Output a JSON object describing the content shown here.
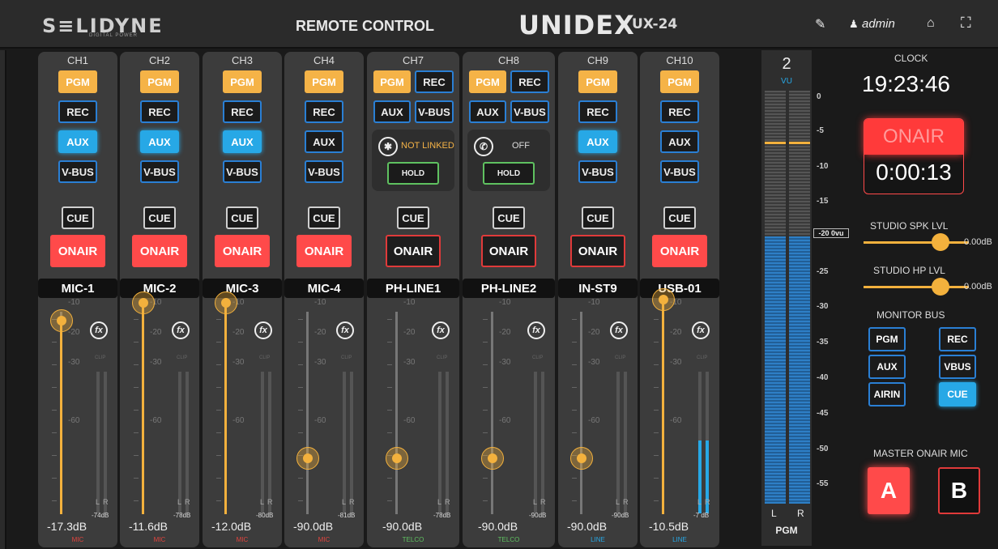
{
  "header": {
    "logo": "S≡LIDYNE",
    "logo_sub": "DIGITAL POWER",
    "title": "REMOTE CONTROL",
    "brand": "UNIDEX",
    "model": "UX-24",
    "user": "admin",
    "icons": [
      "pencil-icon",
      "user-icon",
      "home-icon",
      "fullscreen-icon"
    ]
  },
  "channels": [
    {
      "label": "CH1",
      "name": "MIC-1",
      "gain": "-17.3dB",
      "peak": "-74dB",
      "type": "MIC"
    },
    {
      "label": "CH2",
      "name": "MIC-2",
      "gain": "-11.6dB",
      "peak": "-78dB",
      "type": "MIC"
    },
    {
      "label": "CH3",
      "name": "MIC-3",
      "gain": "-12.0dB",
      "peak": "-80dB",
      "type": "MIC"
    },
    {
      "label": "CH4",
      "name": "MIC-4",
      "gain": "-90.0dB",
      "peak": "-81dB",
      "type": "MIC"
    },
    {
      "label": "CH7",
      "name": "PH-LINE1",
      "gain": "-90.0dB",
      "peak": "-78dB",
      "type": "TELCO",
      "phone_state": "NOT LINKED",
      "hold": "HOLD"
    },
    {
      "label": "CH8",
      "name": "PH-LINE2",
      "gain": "-90.0dB",
      "peak": "-90dB",
      "type": "TELCO",
      "phone_state": "OFF",
      "hold": "HOLD"
    },
    {
      "label": "CH9",
      "name": "IN-ST9",
      "gain": "-90.0dB",
      "peak": "-90dB",
      "type": "LINE"
    },
    {
      "label": "CH10",
      "name": "USB-01",
      "gain": "-10.5dB",
      "peak": "-7 dB",
      "type": "LINE"
    }
  ],
  "buttons": {
    "pgm": "PGM",
    "rec": "REC",
    "aux": "AUX",
    "vbus": "V-BUS",
    "cue": "CUE",
    "onair": "ONAIR"
  },
  "fader_scale": [
    "-10",
    "-20",
    "-30",
    "-60"
  ],
  "clip_label": "CLIP",
  "meter_lr": [
    "L",
    "R"
  ],
  "fx": "fx",
  "pgm_meter": {
    "number": "2",
    "vu": "VU",
    "label": "PGM",
    "left": "L",
    "right": "R",
    "scale": [
      "0",
      "-5",
      "-10",
      "-15",
      "-25",
      "-30",
      "-35",
      "-40",
      "-45",
      "-50",
      "-55"
    ],
    "ref": "-20 0vu"
  },
  "right": {
    "clock_title": "CLOCK",
    "clock": "19:23:46",
    "onair": "ONAIR",
    "onair_time": "0:00:13",
    "spk_title": "STUDIO SPK LVL",
    "spk_val": "0.00dB",
    "hp_title": "STUDIO HP LVL",
    "hp_val": "0.00dB",
    "monitor_title": "MONITOR BUS",
    "monitor": [
      "PGM",
      "REC",
      "AUX",
      "VBUS",
      "AIRIN",
      "CUE"
    ],
    "master_title": "MASTER ONAIR MIC",
    "mic_a": "A",
    "mic_b": "B"
  },
  "colors": {
    "pgm": "#f5b347",
    "aux": "#27a8e6",
    "onair": "#ff4a4a",
    "mic": "#e0443e",
    "telco": "#5fc160",
    "line": "#27a8e6"
  }
}
